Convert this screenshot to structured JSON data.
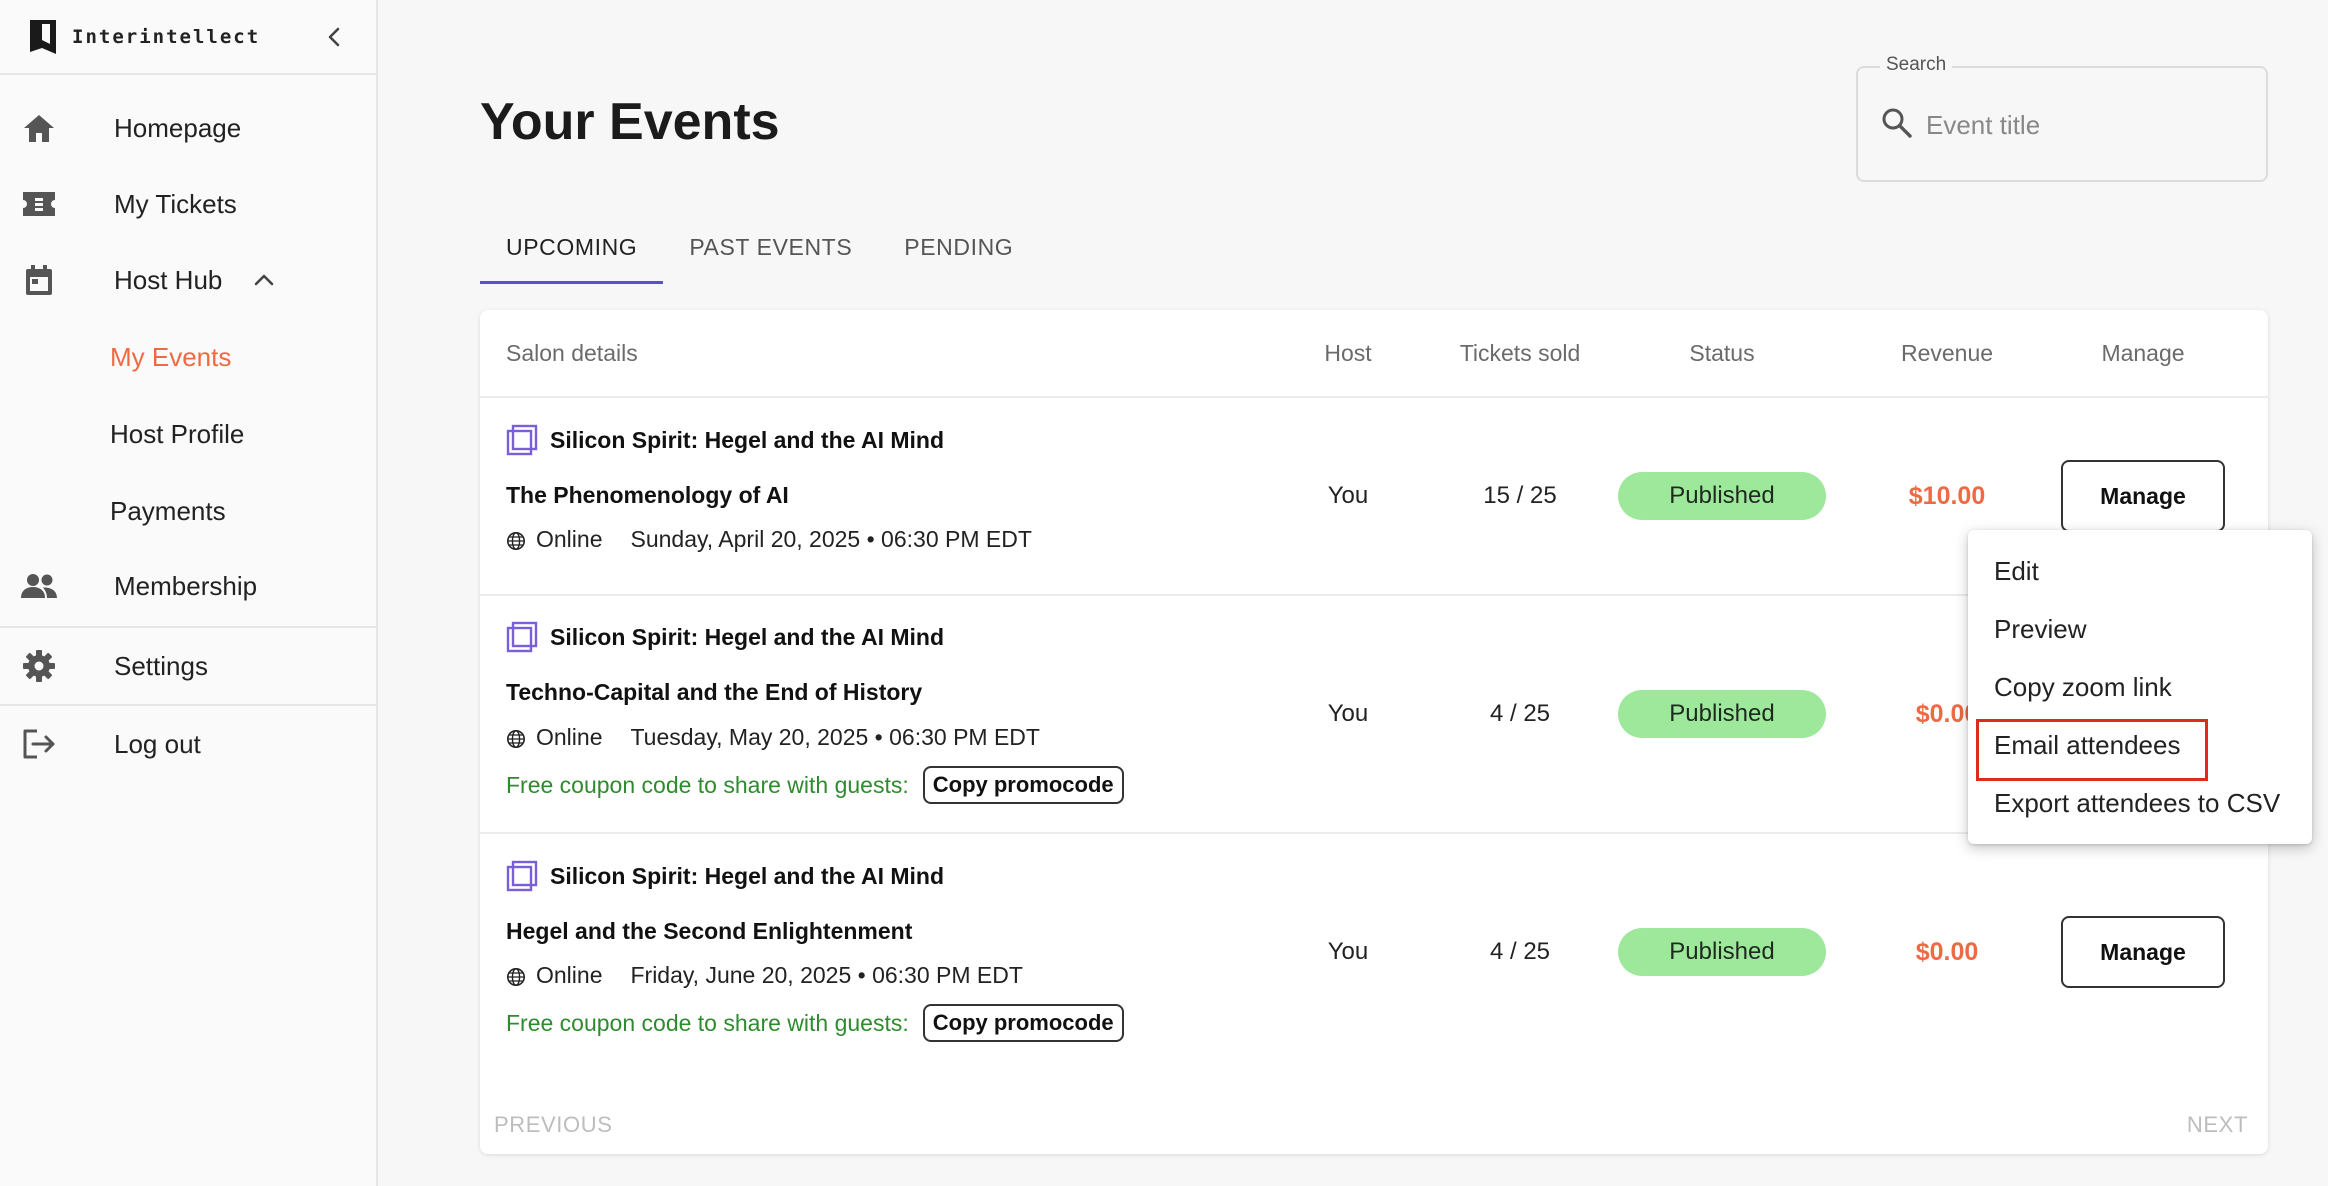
{
  "app": {
    "brand": "Interintellect"
  },
  "sidebar": {
    "items": [
      {
        "label": "Homepage",
        "icon": "home-icon"
      },
      {
        "label": "My Tickets",
        "icon": "ticket-icon"
      },
      {
        "label": "Host Hub",
        "icon": "calendar-icon",
        "expanded": true
      },
      {
        "label": "Membership",
        "icon": "people-icon"
      },
      {
        "label": "Settings",
        "icon": "gear-icon"
      },
      {
        "label": "Log out",
        "icon": "logout-icon"
      }
    ],
    "sub_items": [
      {
        "label": "My Events",
        "active": true
      },
      {
        "label": "Host Profile"
      },
      {
        "label": "Payments"
      }
    ]
  },
  "page": {
    "title": "Your Events"
  },
  "search": {
    "label": "Search",
    "placeholder": "Event title",
    "value": ""
  },
  "tabs": [
    {
      "label": "UPCOMING",
      "active": true
    },
    {
      "label": "PAST EVENTS"
    },
    {
      "label": "PENDING"
    }
  ],
  "table": {
    "headers": [
      "Salon details",
      "Host",
      "Tickets sold",
      "Status",
      "Revenue",
      "Manage"
    ],
    "rows": [
      {
        "series": "Silicon Spirit: Hegel and the AI Mind",
        "title": "The Phenomenology of AI",
        "location": "Online",
        "datetime": "Sunday, April 20, 2025 • 06:30 PM EDT",
        "host": "You",
        "tickets": "15 / 25",
        "status": "Published",
        "revenue": "$10.00",
        "manage_label": "Manage"
      },
      {
        "series": "Silicon Spirit: Hegel and the AI Mind",
        "title": "Techno-Capital and the End of History",
        "location": "Online",
        "datetime": "Tuesday, May 20, 2025 • 06:30 PM EDT",
        "coupon_text": "Free coupon code to share with guests:",
        "promo_label": "Copy promocode",
        "host": "You",
        "tickets": "4 / 25",
        "status": "Published",
        "revenue": "$0.00"
      },
      {
        "series": "Silicon Spirit: Hegel and the AI Mind",
        "title": "Hegel and the Second Enlightenment",
        "location": "Online",
        "datetime": "Friday, June 20, 2025 • 06:30 PM EDT",
        "coupon_text": "Free coupon code to share with guests:",
        "promo_label": "Copy promocode",
        "host": "You",
        "tickets": "4 / 25",
        "status": "Published",
        "revenue": "$0.00",
        "manage_label": "Manage"
      }
    ],
    "pager": {
      "previous": "PREVIOUS",
      "next": "NEXT"
    }
  },
  "manage_menu": {
    "items": [
      "Edit",
      "Preview",
      "Copy zoom link",
      "Email attendees",
      "Export attendees to CSV"
    ],
    "highlighted": "Email attendees"
  },
  "colors": {
    "accent": "#ee6a44",
    "tab_indicator": "#5b4fd6",
    "status_published": "#9ee89c",
    "coupon_text": "#2e8b2e",
    "highlight_border": "#e02a1e"
  }
}
